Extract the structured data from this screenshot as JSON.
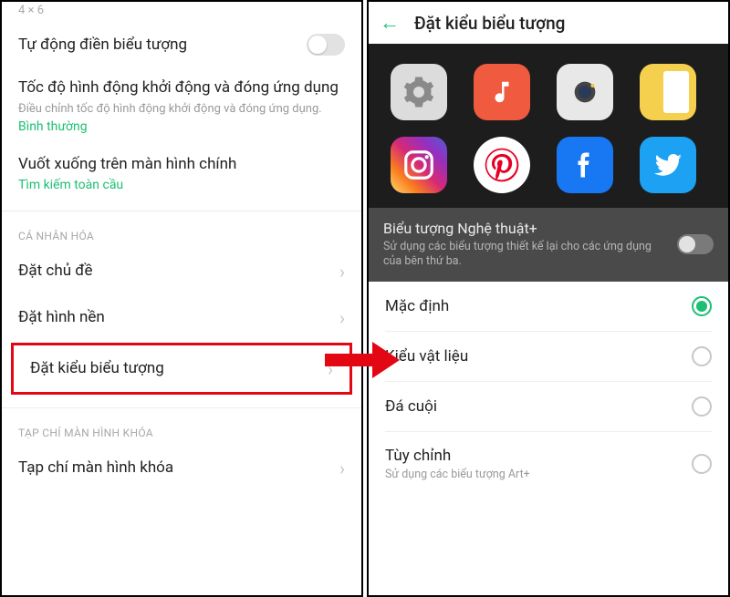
{
  "left": {
    "grid_size": "4 × 6",
    "auto_fill": {
      "label": "Tự động điền biểu tượng"
    },
    "anim_speed": {
      "title": "Tốc độ hình động khởi động và đóng ứng dụng",
      "sub": "Điều chỉnh tốc độ hình động khởi động và đóng ứng dụng.",
      "value": "Bình thường"
    },
    "swipe_down": {
      "title": "Vuốt xuống trên màn hình chính",
      "value": "Tìm kiếm toàn cầu"
    },
    "section_personalize": "CÁ NHÂN HÓA",
    "items": [
      {
        "label": "Đặt chủ đề"
      },
      {
        "label": "Đặt hình nền"
      },
      {
        "label": "Đặt kiểu biểu tượng"
      }
    ],
    "section_lockmag": "TẠP CHÍ MÀN HÌNH KHÓA",
    "lockmag_item": "Tạp chí màn hình khóa"
  },
  "right": {
    "title": "Đặt kiểu biểu tượng",
    "art": {
      "title": "Biểu tượng Nghệ thuật+",
      "sub": "Sử dụng các biểu tượng thiết kế lại cho các ứng dụng của bên thứ ba."
    },
    "options": [
      {
        "label": "Mặc định",
        "selected": true
      },
      {
        "label": "Kiểu vật liệu",
        "selected": false
      },
      {
        "label": "Đá cuội",
        "selected": false
      },
      {
        "label": "Tùy chỉnh",
        "selected": false,
        "sub": "Sử dụng các biểu tượng Art+"
      }
    ]
  }
}
